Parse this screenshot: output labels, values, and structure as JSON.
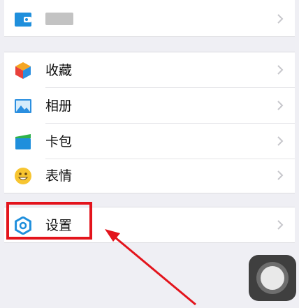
{
  "top_row": {
    "label": ""
  },
  "menu": {
    "favorites": {
      "label": "收藏"
    },
    "album": {
      "label": "相册"
    },
    "cards": {
      "label": "卡包"
    },
    "stickers": {
      "label": "表情"
    }
  },
  "settings": {
    "label": "设置"
  },
  "icons": {
    "wallet": "wallet-icon",
    "favorites": "cube-icon",
    "album": "image-icon",
    "cards": "card-icon",
    "stickers": "smiley-icon",
    "settings": "gear-icon",
    "chevron": "chevron-right-icon"
  },
  "colors": {
    "accent_blue": "#1f8fdc",
    "annotation_red": "#e3141c",
    "background": "#efeff4"
  }
}
